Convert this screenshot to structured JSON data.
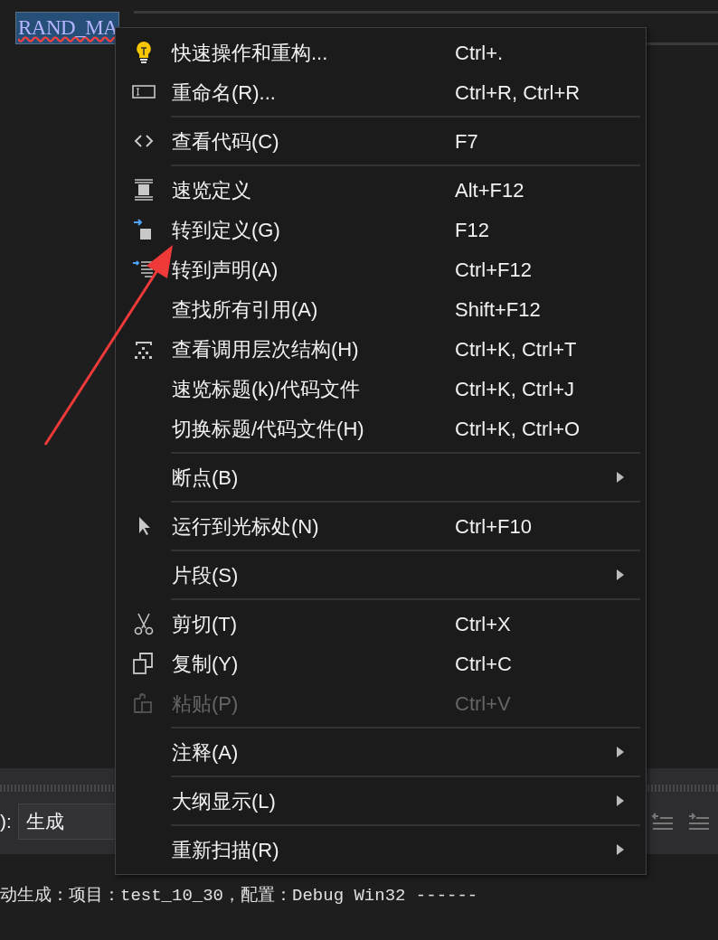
{
  "editor": {
    "code_text": "RAND_MA"
  },
  "context_menu": {
    "groups": [
      [
        {
          "kind": "command",
          "label": "快速操作和重构...",
          "shortcut": "Ctrl+.",
          "disabled": false
        },
        {
          "kind": "command",
          "label": "重命名(R)...",
          "shortcut": "Ctrl+R, Ctrl+R",
          "disabled": false
        }
      ],
      [
        {
          "kind": "command",
          "label": "查看代码(C)",
          "shortcut": "F7",
          "disabled": false
        }
      ],
      [
        {
          "kind": "command",
          "label": "速览定义",
          "shortcut": "Alt+F12",
          "disabled": false
        },
        {
          "kind": "command",
          "label": "转到定义(G)",
          "shortcut": "F12",
          "disabled": false
        },
        {
          "kind": "command",
          "label": "转到声明(A)",
          "shortcut": "Ctrl+F12",
          "disabled": false
        },
        {
          "kind": "command",
          "label": "查找所有引用(A)",
          "shortcut": "Shift+F12",
          "disabled": false
        },
        {
          "kind": "command",
          "label": "查看调用层次结构(H)",
          "shortcut": "Ctrl+K, Ctrl+T",
          "disabled": false
        },
        {
          "kind": "command",
          "label": "速览标题(k)/代码文件",
          "shortcut": "Ctrl+K, Ctrl+J",
          "disabled": false
        },
        {
          "kind": "command",
          "label": "切换标题/代码文件(H)",
          "shortcut": "Ctrl+K, Ctrl+O",
          "disabled": false
        }
      ],
      [
        {
          "kind": "submenu",
          "label": "断点(B)",
          "disabled": false
        }
      ],
      [
        {
          "kind": "command",
          "label": "运行到光标处(N)",
          "shortcut": "Ctrl+F10",
          "disabled": false
        }
      ],
      [
        {
          "kind": "submenu",
          "label": "片段(S)",
          "disabled": false
        }
      ],
      [
        {
          "kind": "command",
          "label": "剪切(T)",
          "shortcut": "Ctrl+X",
          "disabled": false
        },
        {
          "kind": "command",
          "label": "复制(Y)",
          "shortcut": "Ctrl+C",
          "disabled": false
        },
        {
          "kind": "command",
          "label": "粘贴(P)",
          "shortcut": "Ctrl+V",
          "disabled": true
        }
      ],
      [
        {
          "kind": "submenu",
          "label": "注释(A)",
          "disabled": false
        }
      ],
      [
        {
          "kind": "submenu",
          "label": "大纲显示(L)",
          "disabled": false
        }
      ],
      [
        {
          "kind": "submenu",
          "label": "重新扫描(R)",
          "disabled": false
        }
      ]
    ]
  },
  "output_panel": {
    "source_label": "):",
    "source_value": "生成",
    "output_line": "动生成：项目：test_10_30，配置：Debug Win32 ------"
  }
}
